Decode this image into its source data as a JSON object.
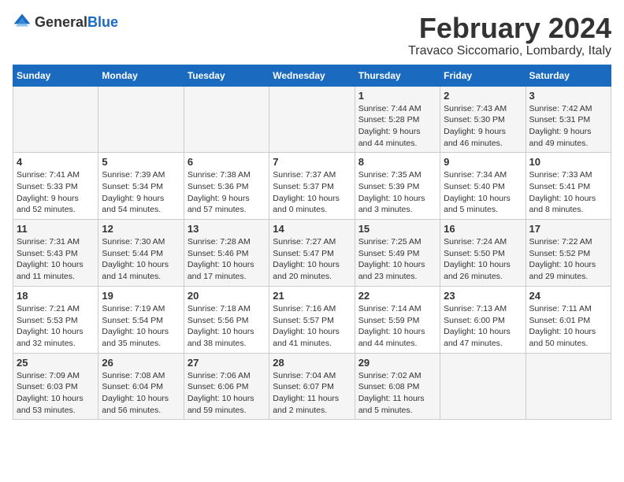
{
  "header": {
    "logo": {
      "general": "General",
      "blue": "Blue"
    },
    "title": "February 2024",
    "location": "Travaco Siccomario, Lombardy, Italy"
  },
  "calendar": {
    "days_of_week": [
      "Sunday",
      "Monday",
      "Tuesday",
      "Wednesday",
      "Thursday",
      "Friday",
      "Saturday"
    ],
    "weeks": [
      [
        {
          "day": "",
          "info": ""
        },
        {
          "day": "",
          "info": ""
        },
        {
          "day": "",
          "info": ""
        },
        {
          "day": "",
          "info": ""
        },
        {
          "day": "1",
          "info": "Sunrise: 7:44 AM\nSunset: 5:28 PM\nDaylight: 9 hours\nand 44 minutes."
        },
        {
          "day": "2",
          "info": "Sunrise: 7:43 AM\nSunset: 5:30 PM\nDaylight: 9 hours\nand 46 minutes."
        },
        {
          "day": "3",
          "info": "Sunrise: 7:42 AM\nSunset: 5:31 PM\nDaylight: 9 hours\nand 49 minutes."
        }
      ],
      [
        {
          "day": "4",
          "info": "Sunrise: 7:41 AM\nSunset: 5:33 PM\nDaylight: 9 hours\nand 52 minutes."
        },
        {
          "day": "5",
          "info": "Sunrise: 7:39 AM\nSunset: 5:34 PM\nDaylight: 9 hours\nand 54 minutes."
        },
        {
          "day": "6",
          "info": "Sunrise: 7:38 AM\nSunset: 5:36 PM\nDaylight: 9 hours\nand 57 minutes."
        },
        {
          "day": "7",
          "info": "Sunrise: 7:37 AM\nSunset: 5:37 PM\nDaylight: 10 hours\nand 0 minutes."
        },
        {
          "day": "8",
          "info": "Sunrise: 7:35 AM\nSunset: 5:39 PM\nDaylight: 10 hours\nand 3 minutes."
        },
        {
          "day": "9",
          "info": "Sunrise: 7:34 AM\nSunset: 5:40 PM\nDaylight: 10 hours\nand 5 minutes."
        },
        {
          "day": "10",
          "info": "Sunrise: 7:33 AM\nSunset: 5:41 PM\nDaylight: 10 hours\nand 8 minutes."
        }
      ],
      [
        {
          "day": "11",
          "info": "Sunrise: 7:31 AM\nSunset: 5:43 PM\nDaylight: 10 hours\nand 11 minutes."
        },
        {
          "day": "12",
          "info": "Sunrise: 7:30 AM\nSunset: 5:44 PM\nDaylight: 10 hours\nand 14 minutes."
        },
        {
          "day": "13",
          "info": "Sunrise: 7:28 AM\nSunset: 5:46 PM\nDaylight: 10 hours\nand 17 minutes."
        },
        {
          "day": "14",
          "info": "Sunrise: 7:27 AM\nSunset: 5:47 PM\nDaylight: 10 hours\nand 20 minutes."
        },
        {
          "day": "15",
          "info": "Sunrise: 7:25 AM\nSunset: 5:49 PM\nDaylight: 10 hours\nand 23 minutes."
        },
        {
          "day": "16",
          "info": "Sunrise: 7:24 AM\nSunset: 5:50 PM\nDaylight: 10 hours\nand 26 minutes."
        },
        {
          "day": "17",
          "info": "Sunrise: 7:22 AM\nSunset: 5:52 PM\nDaylight: 10 hours\nand 29 minutes."
        }
      ],
      [
        {
          "day": "18",
          "info": "Sunrise: 7:21 AM\nSunset: 5:53 PM\nDaylight: 10 hours\nand 32 minutes."
        },
        {
          "day": "19",
          "info": "Sunrise: 7:19 AM\nSunset: 5:54 PM\nDaylight: 10 hours\nand 35 minutes."
        },
        {
          "day": "20",
          "info": "Sunrise: 7:18 AM\nSunset: 5:56 PM\nDaylight: 10 hours\nand 38 minutes."
        },
        {
          "day": "21",
          "info": "Sunrise: 7:16 AM\nSunset: 5:57 PM\nDaylight: 10 hours\nand 41 minutes."
        },
        {
          "day": "22",
          "info": "Sunrise: 7:14 AM\nSunset: 5:59 PM\nDaylight: 10 hours\nand 44 minutes."
        },
        {
          "day": "23",
          "info": "Sunrise: 7:13 AM\nSunset: 6:00 PM\nDaylight: 10 hours\nand 47 minutes."
        },
        {
          "day": "24",
          "info": "Sunrise: 7:11 AM\nSunset: 6:01 PM\nDaylight: 10 hours\nand 50 minutes."
        }
      ],
      [
        {
          "day": "25",
          "info": "Sunrise: 7:09 AM\nSunset: 6:03 PM\nDaylight: 10 hours\nand 53 minutes."
        },
        {
          "day": "26",
          "info": "Sunrise: 7:08 AM\nSunset: 6:04 PM\nDaylight: 10 hours\nand 56 minutes."
        },
        {
          "day": "27",
          "info": "Sunrise: 7:06 AM\nSunset: 6:06 PM\nDaylight: 10 hours\nand 59 minutes."
        },
        {
          "day": "28",
          "info": "Sunrise: 7:04 AM\nSunset: 6:07 PM\nDaylight: 11 hours\nand 2 minutes."
        },
        {
          "day": "29",
          "info": "Sunrise: 7:02 AM\nSunset: 6:08 PM\nDaylight: 11 hours\nand 5 minutes."
        },
        {
          "day": "",
          "info": ""
        },
        {
          "day": "",
          "info": ""
        }
      ]
    ]
  }
}
